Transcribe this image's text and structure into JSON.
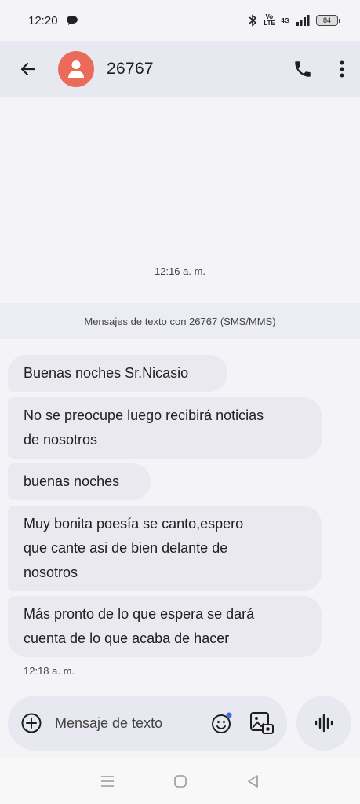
{
  "status_bar": {
    "time": "12:20",
    "volte": "Vo LTE",
    "network": "4G",
    "battery": "84",
    "icons": [
      "chat-bubble-icon",
      "bluetooth-icon",
      "volte-icon",
      "signal-icon",
      "battery-icon"
    ]
  },
  "header": {
    "contact_name": "26767",
    "icons": [
      "back-arrow-icon",
      "person-icon",
      "phone-icon",
      "more-vert-icon"
    ],
    "avatar_color": "#ea6b5a"
  },
  "thread": {
    "date_stamp": "12:16 a. m.",
    "sms_banner": "Mensajes de texto con 26767 (SMS/MMS)",
    "messages": [
      {
        "lines": [
          "Buenas noches Sr.Nicasio"
        ]
      },
      {
        "lines": [
          "No se preocupe luego recibirá noticias",
          "de nosotros"
        ]
      },
      {
        "lines": [
          "buenas noches"
        ]
      },
      {
        "lines": [
          "Muy bonita poesía se canto,espero",
          "que cante asi de bien delante de",
          "nosotros"
        ]
      },
      {
        "lines": [
          "Más pronto de lo que espera se dará",
          "cuenta de lo que acaba de hacer"
        ]
      }
    ],
    "last_time": "12:18 a. m."
  },
  "composer": {
    "placeholder": "Mensaje de texto",
    "icons": [
      "add-circle-icon",
      "emoji-icon",
      "gallery-icon",
      "voice-waveform-icon"
    ]
  },
  "nav_bar": {
    "icons": [
      "menu-icon",
      "home-icon",
      "back-triangle-icon"
    ]
  }
}
